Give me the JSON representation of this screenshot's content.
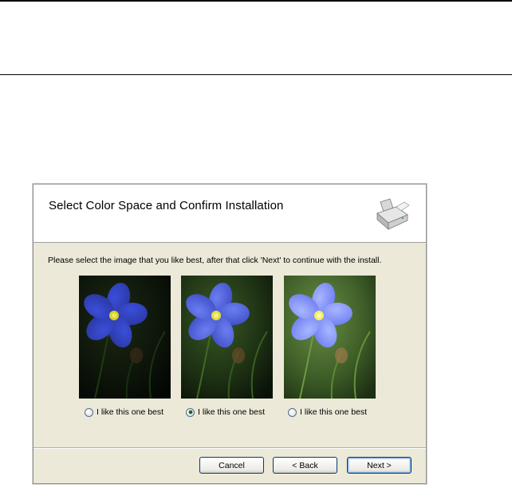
{
  "dialog": {
    "title": "Select Color Space and Confirm Installation",
    "icon": "scanner-icon",
    "instructions": "Please select the image that you like best, after that click 'Next' to continue with the install.",
    "options": [
      {
        "label": "I like this one best",
        "selected": false
      },
      {
        "label": "I like this one best",
        "selected": true
      },
      {
        "label": "I like this one best",
        "selected": false
      }
    ],
    "buttons": {
      "cancel": "Cancel",
      "back": "< Back",
      "next": "Next >"
    }
  },
  "colors": {
    "dialog_bg": "#ece9d8",
    "button_border": "#003c74",
    "flower": "#4a5fe0"
  }
}
